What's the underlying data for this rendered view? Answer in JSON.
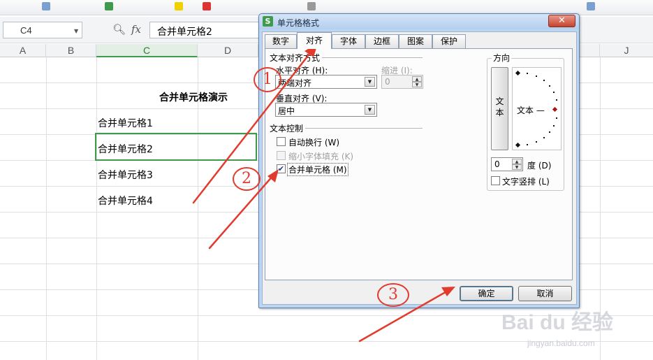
{
  "formula": {
    "name_box": "C4",
    "zoom_icon": "magnifier-icon",
    "fx_label": "fx",
    "content": "合并单元格2"
  },
  "columns": [
    "A",
    "B",
    "C",
    "D",
    "J"
  ],
  "cells": {
    "title": "合并单元格演示",
    "r1": "合并单元格1",
    "r2": "合并单元格2",
    "r3": "合并单元格3",
    "r4": "合并单元格4"
  },
  "dialog": {
    "title": "单元格格式",
    "app_icon": "S",
    "close": "✕",
    "tabs": [
      "数字",
      "对齐",
      "字体",
      "边框",
      "图案",
      "保护"
    ],
    "active_tab": "对齐",
    "alignment_group": "文本对齐方式",
    "horizontal_label": "水平对齐 (H):",
    "horizontal_value": "两端对齐",
    "indent_label": "缩进 (I):",
    "indent_value": "0",
    "vertical_label": "垂直对齐 (V):",
    "vertical_value": "居中",
    "control_group": "文本控制",
    "wrap_text": {
      "label": "自动换行 (W)",
      "checked": false
    },
    "shrink_to_fit": {
      "label": "缩小字体填充 (K)",
      "checked": false,
      "disabled": true
    },
    "merge_cells": {
      "label": "合并单元格 (M)",
      "checked": true
    },
    "orientation_group": "方向",
    "vertical_text_button": "文\n本",
    "dial_text": "文本 —",
    "degree_value": "0",
    "degree_label": "度 (D)",
    "vertical_text_label": "文字竖排 (L)",
    "ok": "确定",
    "cancel": "取消"
  },
  "annotations": {
    "step1": "1",
    "step2": "2",
    "step3": "3",
    "color": "#e23b2e"
  },
  "watermark": {
    "brand": "Bai du 经验",
    "url": "jingyan.baidu.com"
  },
  "colors": {
    "selection_green": "#3f9a4b",
    "dialog_frame": "#bcd6f2",
    "annotation_red": "#e23b2e"
  }
}
